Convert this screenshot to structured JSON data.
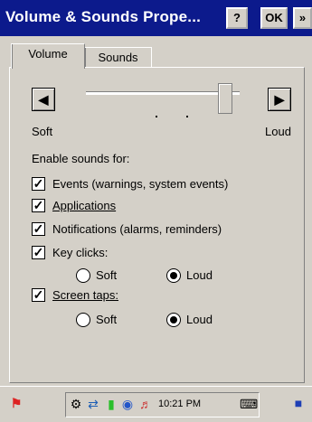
{
  "window": {
    "title": "Volume & Sounds Prope...",
    "help_label": "?",
    "ok_label": "OK",
    "more_label": "»"
  },
  "tabs": [
    {
      "label": "Volume",
      "active": true
    },
    {
      "label": "Sounds",
      "active": false
    }
  ],
  "volume": {
    "soft_label": "Soft",
    "loud_label": "Loud",
    "level": 0.95
  },
  "enable_heading": "Enable sounds for:",
  "options": {
    "events": {
      "label": "Events (warnings, system events)",
      "checked": true
    },
    "applications": {
      "label": "Applications",
      "checked": true
    },
    "notifications": {
      "label": "Notifications (alarms, reminders)",
      "checked": true
    },
    "key_clicks": {
      "label": "Key clicks:",
      "checked": true,
      "soft": "Soft",
      "loud": "Loud",
      "selected": "Loud"
    },
    "screen_taps": {
      "label": "Screen taps:",
      "checked": true,
      "soft": "Soft",
      "loud": "Loud",
      "selected": "Loud"
    }
  },
  "taskbar": {
    "clock": "10:21 PM"
  },
  "colors": {
    "titlebar": "#0c1a8c",
    "face": "#d4d0c8"
  }
}
